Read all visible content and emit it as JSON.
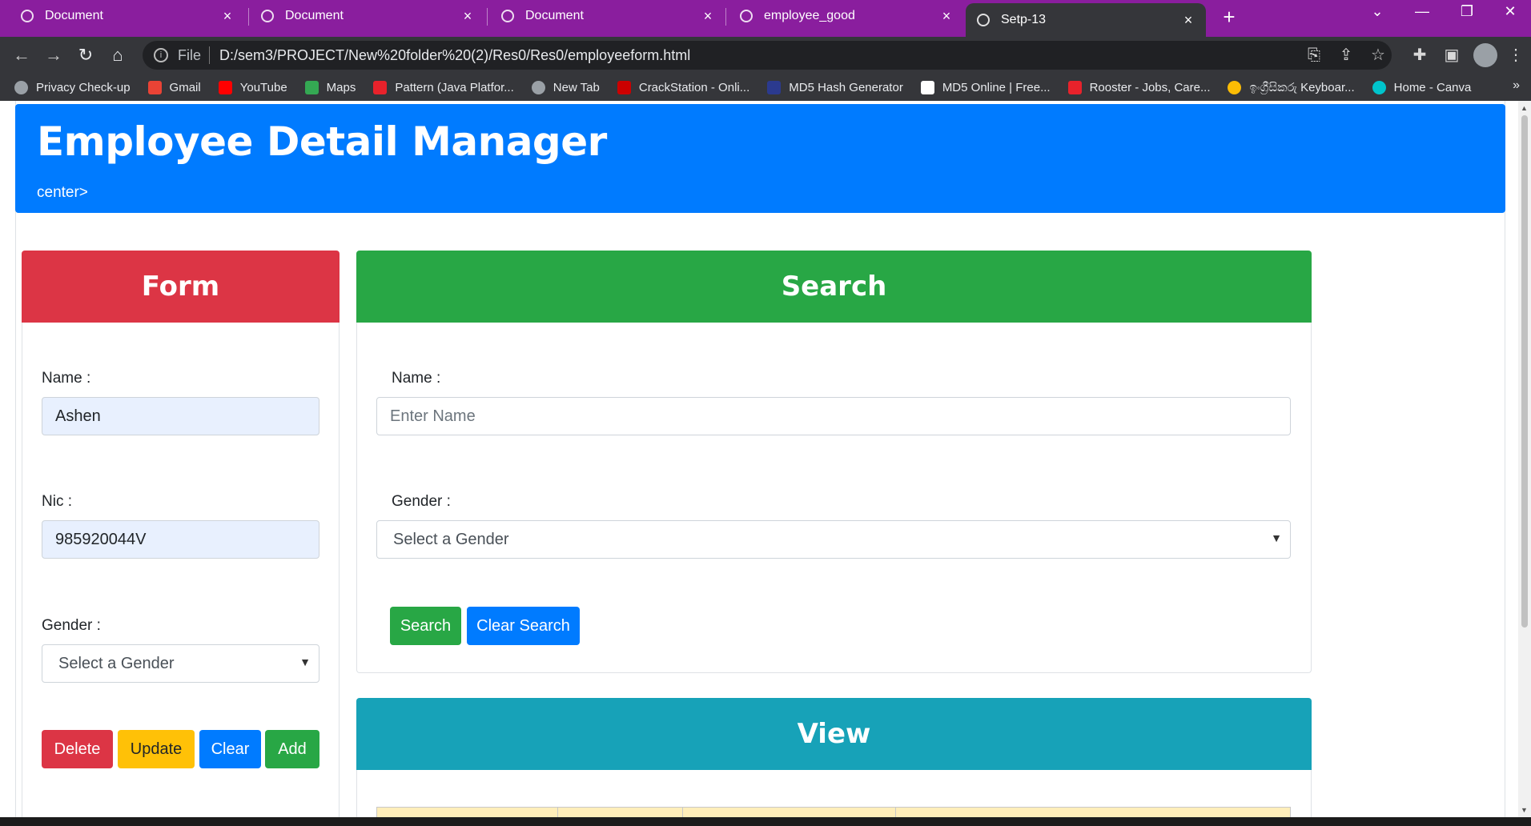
{
  "browser": {
    "tabs": [
      {
        "title": "Document",
        "close": "×"
      },
      {
        "title": "Document",
        "close": "×"
      },
      {
        "title": "Document",
        "close": "×"
      },
      {
        "title": "employee_good",
        "close": "×"
      },
      {
        "title": "Setp-13",
        "close": "×"
      }
    ],
    "new_tab": "+",
    "url_scheme": "File",
    "url": "D:/sem3/PROJECT/New%20folder%20(2)/Res0/Res0/employeeform.html",
    "bookmarks": [
      {
        "label": "Privacy Check-up",
        "color": "#9aa0a6"
      },
      {
        "label": "Gmail",
        "color": "#ea4335"
      },
      {
        "label": "YouTube",
        "color": "#ff0000"
      },
      {
        "label": "Maps",
        "color": "#34a853"
      },
      {
        "label": "Pattern (Java Platfor...",
        "color": "#e8222b"
      },
      {
        "label": "New Tab",
        "color": "#9aa0a6"
      },
      {
        "label": "CrackStation - Onli...",
        "color": "#cc0000"
      },
      {
        "label": "MD5 Hash Generator",
        "color": "#2b3a8f"
      },
      {
        "label": "MD5 Online | Free...",
        "color": "#ffffff"
      },
      {
        "label": "Rooster - Jobs, Care...",
        "color": "#e8222b"
      },
      {
        "label": "ඉංග්‍රීසිකරු Keyboar...",
        "color": "#fbbc05"
      },
      {
        "label": "Home - Canva",
        "color": "#00c4cc"
      }
    ],
    "bookmarks_more": "»"
  },
  "header": {
    "title": "Employee Detail Manager",
    "subtitle": "center>"
  },
  "form": {
    "heading": "Form",
    "name_label": "Name :",
    "name_value": "Ashen",
    "nic_label": "Nic :",
    "nic_value": "985920044V",
    "gender_label": "Gender :",
    "gender_value": "Select a Gender",
    "buttons": {
      "delete": "Delete",
      "update": "Update",
      "clear": "Clear",
      "add": "Add"
    }
  },
  "search": {
    "heading": "Search",
    "name_label": "Name :",
    "name_placeholder": "Enter Name",
    "gender_label": "Gender :",
    "gender_value": "Select a Gender",
    "buttons": {
      "search": "Search",
      "clear": "Clear Search"
    }
  },
  "view": {
    "heading": "View"
  },
  "colors": {
    "tabstrip": "#8a1e9e",
    "primary": "#007bff",
    "danger": "#dc3545",
    "success": "#28a745",
    "warning": "#ffc107",
    "info": "#17a2b8",
    "table_head": "#ffeeba"
  }
}
